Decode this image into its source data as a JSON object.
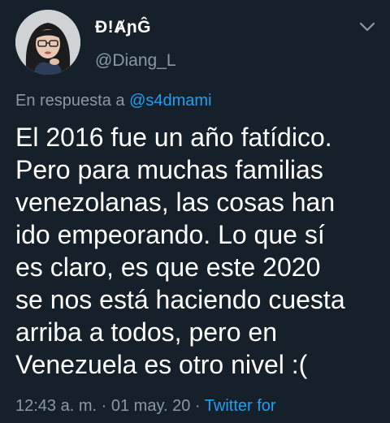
{
  "tweet": {
    "author": {
      "display_name": "Ð!ȺɲĜ",
      "handle": "@Diang_L"
    },
    "reply": {
      "prefix": "En respuesta a",
      "mention": "@s4dmami"
    },
    "text_lines": [
      "El 2016 fue un año fatídico.",
      "Pero para muchas familias",
      "venezolanas, las cosas han",
      "ido empeorando. Lo que sí",
      "es claro, es que este 2020",
      "se nos está haciendo cuesta",
      "arriba a todos, pero en",
      "Venezuela es otro nivel :("
    ],
    "meta": {
      "time": "12:43 a. m.",
      "separator": "·",
      "date": "01 may. 20",
      "source": "Twitter for"
    },
    "icons": {
      "menu": "chevron-down-icon"
    },
    "colors": {
      "background": "#15202b",
      "text": "#ffffff",
      "secondary": "#8899a6",
      "accent": "#1da1f2"
    }
  }
}
